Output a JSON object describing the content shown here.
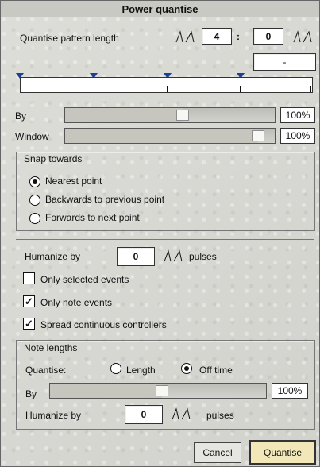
{
  "window": {
    "title": "Power quantise"
  },
  "pattern": {
    "label": "Quantise pattern length",
    "left_value": "4",
    "separator": ":",
    "right_value": "0",
    "small_box_value": "-"
  },
  "ruler": {
    "markers_count": 4
  },
  "by": {
    "label": "By",
    "value": "100%",
    "level": 0.56
  },
  "window_control": {
    "label": "Window",
    "value": "100%",
    "level": 0.92
  },
  "snap": {
    "title": "Snap towards",
    "options": [
      {
        "label": "Nearest point",
        "selected": true
      },
      {
        "label": "Backwards to previous point",
        "selected": false
      },
      {
        "label": "Forwards to next point",
        "selected": false
      }
    ]
  },
  "humanize": {
    "label": "Humanize by",
    "value": "0",
    "unit": "pulses"
  },
  "checks": {
    "selected_events": {
      "label": "Only selected events",
      "checked": false
    },
    "note_events": {
      "label": "Only note events",
      "checked": true
    },
    "spread_controllers": {
      "label": "Spread continuous controllers",
      "checked": true
    }
  },
  "note_lengths": {
    "title": "Note lengths",
    "quantise_label": "Quantise:",
    "length_label": "Length",
    "off_time_label": "Off time",
    "by_label": "By",
    "by_value": "100%",
    "by_level": 0.52,
    "humanize_label": "Humanize by",
    "humanize_value": "0",
    "humanize_unit": "pulses"
  },
  "buttons": {
    "cancel": "Cancel",
    "quantise": "Quantise"
  },
  "colors": {
    "marker": "#1d3f9c",
    "window_bg": "#d9d9d4",
    "title_bg": "#c9c9c3"
  }
}
